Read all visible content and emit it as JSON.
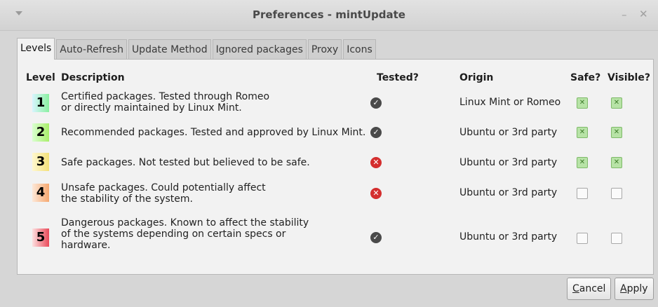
{
  "window": {
    "title": "Preferences - mintUpdate",
    "menu_icon": "chevron-down-icon",
    "minimize_icon": "minimize-icon",
    "close_icon": "close-icon"
  },
  "tabs": [
    {
      "label": "Levels",
      "active": true
    },
    {
      "label": "Auto-Refresh"
    },
    {
      "label": "Update Method"
    },
    {
      "label": "Ignored packages"
    },
    {
      "label": "Proxy"
    },
    {
      "label": "Icons"
    }
  ],
  "table": {
    "headers": {
      "level": "Level",
      "description": "Description",
      "tested": "Tested?",
      "origin": "Origin",
      "safe": "Safe?",
      "visible": "Visible?"
    },
    "rows": [
      {
        "level": "1",
        "description": [
          "Certified packages. Tested through Romeo",
          "or directly maintained by Linux Mint."
        ],
        "tested": true,
        "origin": "Linux Mint or Romeo",
        "safe": true,
        "visible": true
      },
      {
        "level": "2",
        "description": [
          "Recommended packages. Tested and approved by Linux Mint."
        ],
        "tested": true,
        "origin": "Ubuntu or 3rd party",
        "safe": true,
        "visible": true
      },
      {
        "level": "3",
        "description": [
          "Safe packages. Not tested but believed to be safe."
        ],
        "tested": false,
        "origin": "Ubuntu or 3rd party",
        "safe": true,
        "visible": true
      },
      {
        "level": "4",
        "description": [
          "Unsafe packages. Could potentially affect",
          "the stability of the system."
        ],
        "tested": false,
        "origin": "Ubuntu or 3rd party",
        "safe": false,
        "visible": false
      },
      {
        "level": "5",
        "description": [
          "Dangerous packages. Known to affect the stability",
          "of the systems depending on certain specs or",
          "hardware."
        ],
        "tested": true,
        "origin": "Ubuntu or 3rd party",
        "safe": false,
        "visible": false
      }
    ],
    "tested_icons": {
      "true": "check-circle-icon",
      "false": "x-circle-icon"
    }
  },
  "buttons": {
    "cancel": {
      "label": "Cancel",
      "mnemonic": "C"
    },
    "apply": {
      "label": "Apply",
      "mnemonic": "A"
    }
  },
  "colors": {
    "level1": "#8af0a0",
    "level2": "#a9ee6a",
    "level3": "#f3e07a",
    "level4": "#f6a870",
    "level5": "#e94a5a",
    "tested_ok": "#4a4a4a",
    "tested_bad": "#d42e2e"
  }
}
